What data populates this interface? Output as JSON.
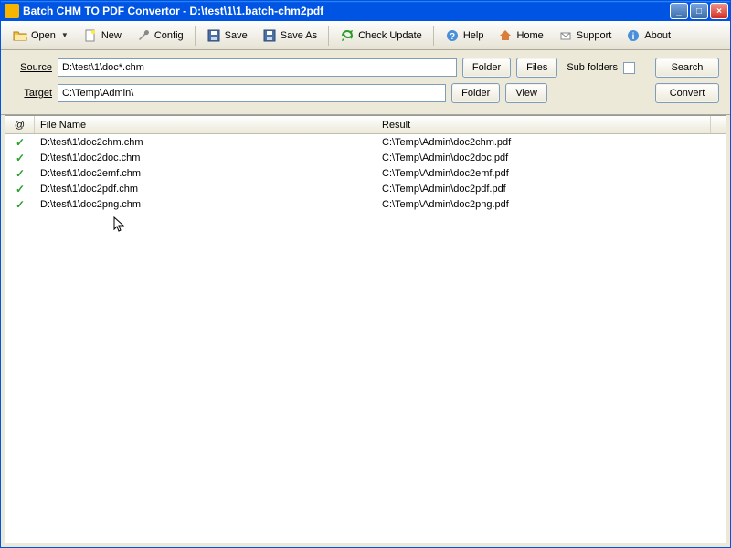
{
  "window": {
    "title": "Batch CHM TO PDF Convertor - D:\\test\\1\\1.batch-chm2pdf"
  },
  "toolbar": {
    "open": "Open",
    "new": "New",
    "config": "Config",
    "save": "Save",
    "saveas": "Save As",
    "checkupdate": "Check Update",
    "help": "Help",
    "home": "Home",
    "support": "Support",
    "about": "About"
  },
  "form": {
    "source_label": "Source",
    "source_value": "D:\\test\\1\\doc*.chm",
    "target_label": "Target",
    "target_value": "C:\\Temp\\Admin\\",
    "folder_btn": "Folder",
    "files_btn": "Files",
    "view_btn": "View",
    "subfolders_label": "Sub folders",
    "search_btn": "Search",
    "convert_btn": "Convert"
  },
  "list": {
    "col_status": "@",
    "col_file": "File Name",
    "col_result": "Result",
    "rows": [
      {
        "file": "D:\\test\\1\\doc2chm.chm",
        "result": "C:\\Temp\\Admin\\doc2chm.pdf"
      },
      {
        "file": "D:\\test\\1\\doc2doc.chm",
        "result": "C:\\Temp\\Admin\\doc2doc.pdf"
      },
      {
        "file": "D:\\test\\1\\doc2emf.chm",
        "result": "C:\\Temp\\Admin\\doc2emf.pdf"
      },
      {
        "file": "D:\\test\\1\\doc2pdf.chm",
        "result": "C:\\Temp\\Admin\\doc2pdf.pdf"
      },
      {
        "file": "D:\\test\\1\\doc2png.chm",
        "result": "C:\\Temp\\Admin\\doc2png.pdf"
      }
    ]
  }
}
